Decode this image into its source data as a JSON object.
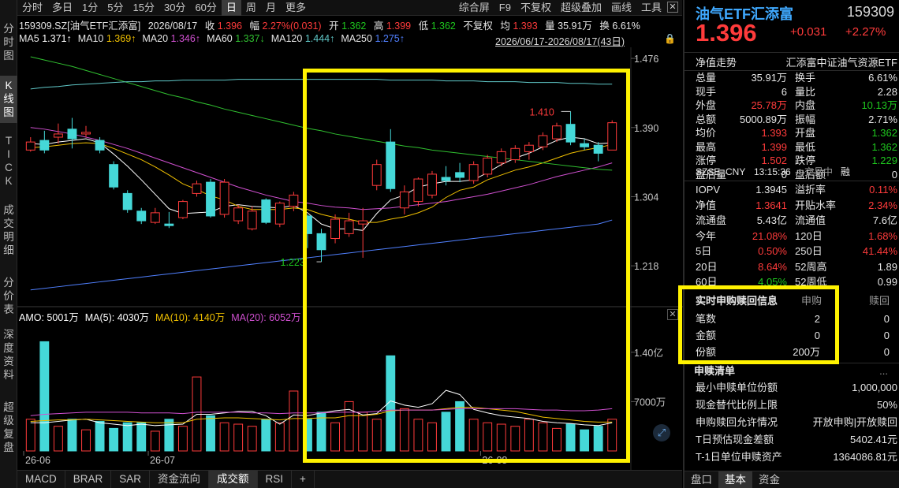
{
  "left_tabs": [
    "分时图",
    "K线图",
    "TICK",
    "成交明细",
    "分价表",
    "深度资料",
    "超级复盘"
  ],
  "toolbar": {
    "items": [
      "分时",
      "多日",
      "1分",
      "5分",
      "15分",
      "30分",
      "60分",
      "日",
      "周",
      "月",
      "更多"
    ],
    "active": "日",
    "right_items": [
      "综合屏",
      "F9",
      "不复权",
      "超级叠加",
      "画线",
      "工具"
    ]
  },
  "info": {
    "code_name": "159309.SZ[油气ETF汇添富]",
    "date": "2026/08/17",
    "close_label": "收",
    "close": "1.396",
    "change_label": "幅",
    "change": "2.27%(0.031)",
    "open_label": "开",
    "open": "1.362",
    "high_label": "高",
    "high": "1.399",
    "low_label": "低",
    "low": "1.362",
    "adjust": "不复权",
    "avg_label": "均",
    "avg": "1.393",
    "amount_label": "量",
    "amount": "35.91万",
    "turnover_label": "换",
    "turnover": "6.61%"
  },
  "ma_line": [
    {
      "label": "MA5",
      "value": "1.371↑",
      "color": "#ffffff"
    },
    {
      "label": "MA10",
      "value": "1.369↑",
      "color": "#f0c000"
    },
    {
      "label": "MA20",
      "value": "1.346↑",
      "color": "#d050d0"
    },
    {
      "label": "MA60",
      "value": "1.337↓",
      "color": "#30c030"
    },
    {
      "label": "MA120",
      "value": "1.444↑",
      "color": "#60c8c8"
    },
    {
      "label": "MA250",
      "value": "1.275↑",
      "color": "#5080ff"
    }
  ],
  "range": "2026/06/17-2026/08/17(43日)",
  "amo_line": [
    {
      "label": "AMO: 5001万",
      "color": "#ffffff"
    },
    {
      "label": "MA(5): 4030万",
      "color": "#ffffff"
    },
    {
      "label": "MA(10): 4140万",
      "color": "#f0c000"
    },
    {
      "label": "MA(20): 6052万",
      "color": "#d050d0"
    }
  ],
  "bottom_tabs": [
    "MACD",
    "BRAR",
    "SAR",
    "资金流向",
    "成交额",
    "RSI",
    "+"
  ],
  "bottom_active": "成交额",
  "right_panel": {
    "name": "油气ETF汇添富",
    "code": "159309",
    "price": "1.396",
    "change": "+0.031",
    "change_pct": "+2.27%",
    "nav_trend_label": "净值走势",
    "fund_full_name": "汇添富中证油气资源ETF",
    "stats": [
      [
        "总量",
        "35.91万",
        "换手",
        "6.61%"
      ],
      [
        "现手",
        "6",
        "量比",
        "2.28"
      ],
      [
        "外盘",
        "25.78万",
        "内盘",
        "10.13万"
      ],
      [
        "总额",
        "5000.89万",
        "振幅",
        "2.71%"
      ],
      [
        "均价",
        "1.393",
        "开盘",
        "1.362"
      ],
      [
        "最高",
        "1.399",
        "最低",
        "1.362"
      ],
      [
        "涨停",
        "1.502",
        "跌停",
        "1.229"
      ],
      [
        "盘后量",
        "0",
        "盘后额",
        "0"
      ]
    ],
    "exchange": "SZSE",
    "currency": "CNY",
    "time": "13:15:36",
    "status": "交易中",
    "margin": "融",
    "stats2": [
      [
        "IOPV",
        "1.3945",
        "溢折率",
        "0.11%"
      ],
      [
        "净值",
        "1.3641",
        "开贴水率",
        "2.34%"
      ],
      [
        "流通盘",
        "5.43亿",
        "流通值",
        "7.6亿"
      ],
      [
        "今年",
        "21.08%",
        "120日",
        "1.68%"
      ],
      [
        "5日",
        "0.50%",
        "250日",
        "41.44%"
      ],
      [
        "20日",
        "8.64%",
        "52周高",
        "1.89"
      ],
      [
        "60日",
        "4.05%",
        "52周低",
        "0.99"
      ]
    ],
    "realtime": {
      "title": "实时申购赎回信息",
      "col1": "申购",
      "col2": "赎回",
      "rows": [
        [
          "笔数",
          "2",
          "0"
        ],
        [
          "金额",
          "0",
          "0"
        ],
        [
          "份额",
          "200万",
          "0"
        ]
      ]
    },
    "redeem_list": {
      "title": "申赎清单",
      "more": "...",
      "rows": [
        [
          "最小申赎单位份额",
          "1,000,000"
        ],
        [
          "现金替代比例上限",
          "50%"
        ],
        [
          "申购赎回允许情况",
          "开放申购|开放赎回"
        ],
        [
          "T日预估现金差额",
          "5402.41元"
        ],
        [
          "T-1日单位申赎资产",
          "1364086.81元"
        ]
      ]
    },
    "bottom_tabs": [
      "盘口",
      "基本",
      "资金"
    ],
    "bottom_active": "基本"
  },
  "chart_data": [
    {
      "type": "candlestick",
      "y_ticks": [
        "1.476",
        "1.390",
        "1.304",
        "1.218"
      ],
      "ylim": [
        1.176,
        1.48
      ],
      "x_tick_labels": [
        "26-06",
        "26-07",
        "26-08"
      ],
      "annotations": [
        {
          "label": "1.410",
          "value": 1.41
        },
        {
          "label": "1.223",
          "value": 1.223
        }
      ],
      "candles": [
        {
          "o": 1.362,
          "c": 1.372,
          "h": 1.378,
          "l": 1.36
        },
        {
          "o": 1.374,
          "c": 1.362,
          "h": 1.386,
          "l": 1.358
        },
        {
          "o": 1.378,
          "c": 1.382,
          "h": 1.395,
          "l": 1.37
        },
        {
          "o": 1.388,
          "c": 1.376,
          "h": 1.402,
          "l": 1.364
        },
        {
          "o": 1.382,
          "c": 1.384,
          "h": 1.392,
          "l": 1.378
        },
        {
          "o": 1.374,
          "c": 1.362,
          "h": 1.378,
          "l": 1.358
        },
        {
          "o": 1.344,
          "c": 1.316,
          "h": 1.348,
          "l": 1.313
        },
        {
          "o": 1.308,
          "c": 1.288,
          "h": 1.312,
          "l": 1.284
        },
        {
          "o": 1.286,
          "c": 1.274,
          "h": 1.29,
          "l": 1.27
        },
        {
          "o": 1.272,
          "c": 1.284,
          "h": 1.29,
          "l": 1.27
        },
        {
          "o": 1.27,
          "c": 1.268,
          "h": 1.285,
          "l": 1.265
        },
        {
          "o": 1.278,
          "c": 1.298,
          "h": 1.3,
          "l": 1.276
        },
        {
          "o": 1.308,
          "c": 1.32,
          "h": 1.324,
          "l": 1.304
        },
        {
          "o": 1.322,
          "c": 1.28,
          "h": 1.326,
          "l": 1.278
        },
        {
          "o": 1.282,
          "c": 1.322,
          "h": 1.326,
          "l": 1.278
        },
        {
          "o": 1.274,
          "c": 1.29,
          "h": 1.294,
          "l": 1.27
        },
        {
          "o": 1.264,
          "c": 1.286,
          "h": 1.292,
          "l": 1.262
        },
        {
          "o": 1.3,
          "c": 1.272,
          "h": 1.302,
          "l": 1.27
        },
        {
          "o": 1.27,
          "c": 1.296,
          "h": 1.298,
          "l": 1.266
        },
        {
          "o": 1.292,
          "c": 1.306,
          "h": 1.31,
          "l": 1.286
        },
        {
          "o": 1.28,
          "c": 1.258,
          "h": 1.282,
          "l": 1.24
        },
        {
          "o": 1.258,
          "c": 1.238,
          "h": 1.264,
          "l": 1.223
        },
        {
          "o": 1.252,
          "c": 1.276,
          "h": 1.282,
          "l": 1.246
        },
        {
          "o": 1.258,
          "c": 1.274,
          "h": 1.284,
          "l": 1.254
        },
        {
          "o": 1.27,
          "c": 1.274,
          "h": 1.29,
          "l": 1.228
        },
        {
          "o": 1.318,
          "c": 1.344,
          "h": 1.35,
          "l": 1.312
        },
        {
          "o": 1.372,
          "c": 1.314,
          "h": 1.388,
          "l": 1.31
        },
        {
          "o": 1.29,
          "c": 1.31,
          "h": 1.318,
          "l": 1.282
        },
        {
          "o": 1.298,
          "c": 1.326,
          "h": 1.328,
          "l": 1.292
        },
        {
          "o": 1.306,
          "c": 1.332,
          "h": 1.336,
          "l": 1.302
        },
        {
          "o": 1.328,
          "c": 1.324,
          "h": 1.342,
          "l": 1.318
        },
        {
          "o": 1.334,
          "c": 1.328,
          "h": 1.346,
          "l": 1.322
        },
        {
          "o": 1.324,
          "c": 1.344,
          "h": 1.348,
          "l": 1.32
        },
        {
          "o": 1.332,
          "c": 1.352,
          "h": 1.356,
          "l": 1.328
        },
        {
          "o": 1.346,
          "c": 1.36,
          "h": 1.364,
          "l": 1.342
        },
        {
          "o": 1.35,
          "c": 1.364,
          "h": 1.368,
          "l": 1.346
        },
        {
          "o": 1.36,
          "c": 1.368,
          "h": 1.372,
          "l": 1.35
        },
        {
          "o": 1.366,
          "c": 1.38,
          "h": 1.384,
          "l": 1.362
        },
        {
          "o": 1.376,
          "c": 1.392,
          "h": 1.396,
          "l": 1.372
        },
        {
          "o": 1.394,
          "c": 1.372,
          "h": 1.41,
          "l": 1.368
        },
        {
          "o": 1.37,
          "c": 1.366,
          "h": 1.376,
          "l": 1.362
        },
        {
          "o": 1.368,
          "c": 1.358,
          "h": 1.372,
          "l": 1.348
        },
        {
          "o": 1.362,
          "c": 1.396,
          "h": 1.399,
          "l": 1.362
        }
      ],
      "ma5": [
        1.37,
        1.369,
        1.372,
        1.374,
        1.376,
        1.371,
        1.357,
        1.342,
        1.325,
        1.307,
        1.289,
        1.283,
        1.284,
        1.285,
        1.292,
        1.294,
        1.292,
        1.291,
        1.29,
        1.293,
        1.284,
        1.27,
        1.264,
        1.264,
        1.262,
        1.283,
        1.3,
        1.306,
        1.316,
        1.32,
        1.323,
        1.323,
        1.325,
        1.334,
        1.344,
        1.352,
        1.358,
        1.366,
        1.374,
        1.378,
        1.376,
        1.37,
        1.371
      ],
      "ma10": [
        1.365,
        1.366,
        1.368,
        1.37,
        1.371,
        1.37,
        1.364,
        1.357,
        1.35,
        1.341,
        1.331,
        1.32,
        1.313,
        1.305,
        1.3,
        1.292,
        1.288,
        1.288,
        1.288,
        1.29,
        1.288,
        1.282,
        1.278,
        1.276,
        1.272,
        1.272,
        1.276,
        1.279,
        1.284,
        1.291,
        1.303,
        1.312,
        1.316,
        1.325,
        1.331,
        1.337,
        1.341,
        1.346,
        1.352,
        1.358,
        1.362,
        1.365,
        1.369
      ],
      "ma20": [
        1.39,
        1.388,
        1.385,
        1.382,
        1.378,
        1.374,
        1.369,
        1.364,
        1.358,
        1.352,
        1.346,
        1.34,
        1.334,
        1.328,
        1.322,
        1.316,
        1.311,
        1.306,
        1.302,
        1.298,
        1.296,
        1.293,
        1.291,
        1.29,
        1.288,
        1.289,
        1.29,
        1.292,
        1.294,
        1.296,
        1.298,
        1.301,
        1.304,
        1.307,
        1.311,
        1.315,
        1.319,
        1.324,
        1.329,
        1.333,
        1.337,
        1.341,
        1.346
      ],
      "ma60": [
        1.478,
        1.474,
        1.47,
        1.466,
        1.461,
        1.456,
        1.451,
        1.446,
        1.441,
        1.436,
        1.431,
        1.427,
        1.422,
        1.418,
        1.413,
        1.409,
        1.405,
        1.401,
        1.397,
        1.393,
        1.389,
        1.386,
        1.382,
        1.379,
        1.376,
        1.373,
        1.37,
        1.367,
        1.365,
        1.362,
        1.36,
        1.358,
        1.356,
        1.354,
        1.352,
        1.35,
        1.348,
        1.346,
        1.344,
        1.342,
        1.34,
        1.338,
        1.337
      ],
      "ma120": [
        1.438,
        1.44,
        1.441,
        1.443,
        1.444,
        1.445,
        1.446,
        1.447,
        1.447,
        1.448,
        1.448,
        1.449,
        1.449,
        1.449,
        1.449,
        1.45,
        1.45,
        1.45,
        1.45,
        1.45,
        1.45,
        1.45,
        1.45,
        1.45,
        1.45,
        1.45,
        1.449,
        1.449,
        1.449,
        1.449,
        1.448,
        1.448,
        1.448,
        1.447,
        1.447,
        1.447,
        1.446,
        1.446,
        1.446,
        1.445,
        1.445,
        1.444,
        1.444
      ],
      "ma250": [
        1.188,
        1.19,
        1.192,
        1.194,
        1.196,
        1.198,
        1.2,
        1.202,
        1.204,
        1.206,
        1.208,
        1.21,
        1.212,
        1.214,
        1.216,
        1.218,
        1.22,
        1.222,
        1.224,
        1.226,
        1.228,
        1.23,
        1.232,
        1.234,
        1.236,
        1.238,
        1.24,
        1.242,
        1.244,
        1.246,
        1.248,
        1.25,
        1.252,
        1.254,
        1.256,
        1.258,
        1.26,
        1.262,
        1.264,
        1.266,
        1.268,
        1.27,
        1.275
      ]
    },
    {
      "type": "bar",
      "title": "AMO",
      "y_ticks": [
        "1.40亿",
        "7000万"
      ],
      "ylim": [
        0,
        1.7
      ],
      "unit_note": "亿",
      "values": [
        0.45,
        1.55,
        0.35,
        0.45,
        0.3,
        0.42,
        0.32,
        0.4,
        0.4,
        0.28,
        0.45,
        0.35,
        1.05,
        0.5,
        0.4,
        0.38,
        0.35,
        0.45,
        0.4,
        0.85,
        0.45,
        0.55,
        0.4,
        0.7,
        0.55,
        0.45,
        1.35,
        0.6,
        0.45,
        0.4,
        0.55,
        0.7,
        0.45,
        0.4,
        0.38,
        0.35,
        0.45,
        0.4,
        0.32,
        0.38,
        0.3,
        0.35,
        0.45
      ],
      "ma5": [
        0.4,
        0.4,
        0.42,
        0.44,
        0.45,
        0.4,
        0.38,
        0.36,
        0.38,
        0.36,
        0.37,
        0.38,
        0.52,
        0.52,
        0.54,
        0.56,
        0.56,
        0.5,
        0.38,
        0.51,
        0.5,
        0.54,
        0.57,
        0.59,
        0.51,
        0.53,
        0.71,
        0.65,
        0.62,
        0.67,
        0.86,
        0.8,
        0.59,
        0.54,
        0.5,
        0.48,
        0.46,
        0.42,
        0.4,
        0.39,
        0.37,
        0.36,
        0.4
      ],
      "ma10": [
        0.42,
        0.43,
        0.44,
        0.44,
        0.45,
        0.44,
        0.43,
        0.42,
        0.41,
        0.4,
        0.4,
        0.4,
        0.45,
        0.46,
        0.47,
        0.47,
        0.46,
        0.45,
        0.44,
        0.46,
        0.46,
        0.47,
        0.47,
        0.5,
        0.5,
        0.52,
        0.57,
        0.58,
        0.58,
        0.58,
        0.6,
        0.62,
        0.62,
        0.6,
        0.58,
        0.56,
        0.52,
        0.48,
        0.46,
        0.44,
        0.42,
        0.41,
        0.41
      ],
      "ma20": [
        0.5,
        0.52,
        0.53,
        0.54,
        0.55,
        0.55,
        0.55,
        0.55,
        0.54,
        0.54,
        0.54,
        0.53,
        0.55,
        0.55,
        0.55,
        0.55,
        0.54,
        0.54,
        0.53,
        0.54,
        0.54,
        0.54,
        0.55,
        0.55,
        0.55,
        0.56,
        0.58,
        0.58,
        0.58,
        0.58,
        0.59,
        0.6,
        0.6,
        0.6,
        0.6,
        0.6,
        0.59,
        0.58,
        0.58,
        0.57,
        0.57,
        0.58,
        0.6
      ]
    }
  ]
}
